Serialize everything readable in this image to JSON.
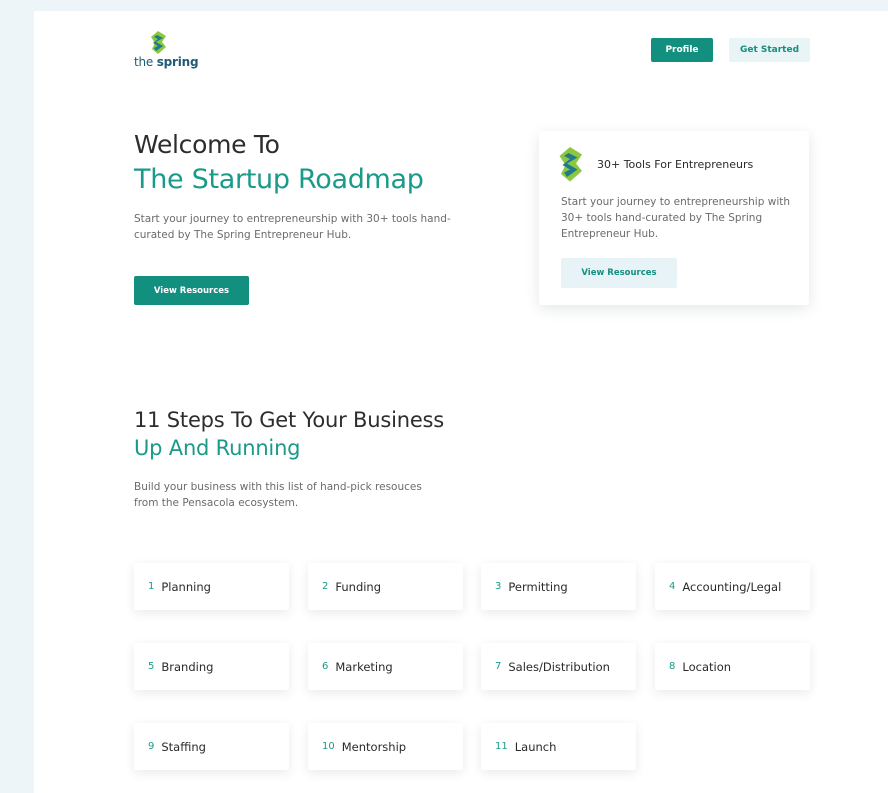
{
  "colors": {
    "accent": "#138f80",
    "accent_text": "#1a9a88",
    "light_button": "#e9f4f6",
    "background": "#eef5f9",
    "logo_green": "#8dc63f",
    "logo_teal": "#1f7a8c"
  },
  "header": {
    "logo": {
      "prefix": "the",
      "brand": "spring",
      "icon": "spring-logo-icon"
    },
    "profile_label": "Profile",
    "get_started_label": "Get Started"
  },
  "hero": {
    "title_line1": "Welcome To",
    "title_line2": "The Startup Roadmap",
    "description": "Start your journey to entrepreneurship with 30+ tools hand-curated by The Spring Entrepreneur Hub.",
    "button_label": "View Resources"
  },
  "card": {
    "icon": "spring-logo-icon",
    "title": "30+ Tools For Entrepreneurs",
    "description": "Start your journey to entrepreneurship with 30+ tools hand-curated by The Spring Entrepreneur Hub.",
    "button_label": "View Resources"
  },
  "steps": {
    "title_line1": "11 Steps To Get Your Business",
    "title_line2": "Up And Running",
    "description": "Build your business with this list of hand-pick resouces from the Pensacola ecosystem.",
    "items": [
      {
        "number": "1",
        "label": "Planning"
      },
      {
        "number": "2",
        "label": "Funding"
      },
      {
        "number": "3",
        "label": "Permitting"
      },
      {
        "number": "4",
        "label": "Accounting/Legal"
      },
      {
        "number": "5",
        "label": "Branding"
      },
      {
        "number": "6",
        "label": "Marketing"
      },
      {
        "number": "7",
        "label": "Sales/Distribution"
      },
      {
        "number": "8",
        "label": "Location"
      },
      {
        "number": "9",
        "label": "Staffing"
      },
      {
        "number": "10",
        "label": "Mentorship"
      },
      {
        "number": "11",
        "label": "Launch"
      }
    ]
  }
}
